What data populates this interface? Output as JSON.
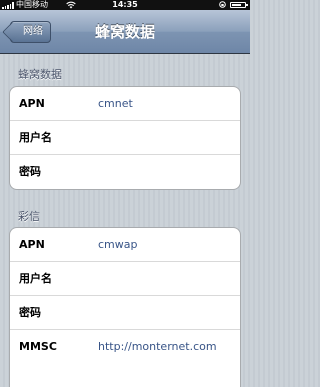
{
  "status_bar": {
    "carrier": "中国移动",
    "time": "14:35"
  },
  "nav": {
    "back_label": "网络",
    "title": "蜂窝数据"
  },
  "cellular": {
    "header": "蜂窝数据",
    "rows": [
      {
        "label": "APN",
        "value": "cmnet"
      },
      {
        "label": "用户名",
        "value": ""
      },
      {
        "label": "密码",
        "value": ""
      }
    ]
  },
  "mms": {
    "header": "彩信",
    "rows": [
      {
        "label": "APN",
        "value": "cmwap"
      },
      {
        "label": "用户名",
        "value": ""
      },
      {
        "label": "密码",
        "value": ""
      },
      {
        "label": "MMSC",
        "value": "http://monternet.com"
      }
    ]
  },
  "colors": {
    "nav_accent": "#6e86a7",
    "value_text": "#385487",
    "background": "#c5ccd4"
  }
}
